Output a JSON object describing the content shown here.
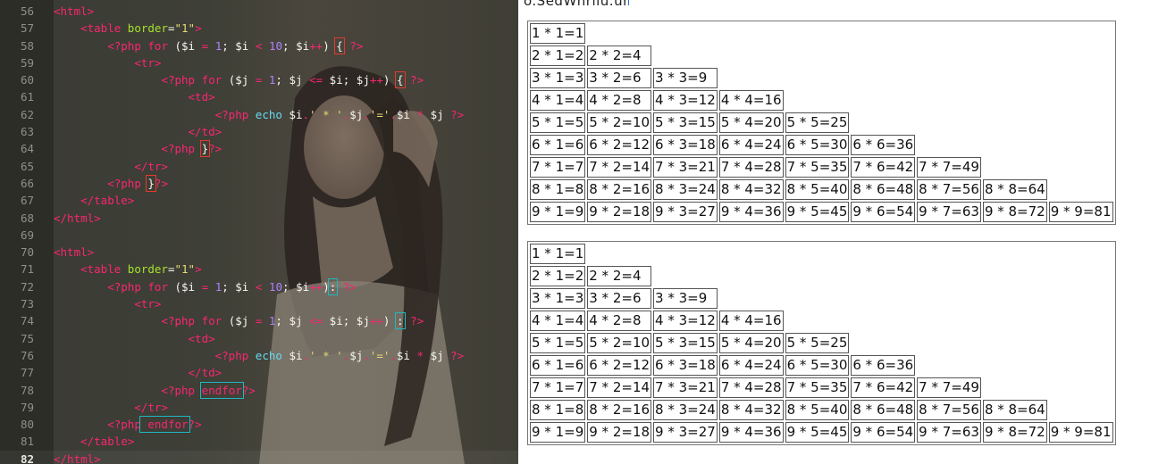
{
  "editor": {
    "lines": [
      {
        "n": "56",
        "tokens": [
          [
            "t-tag",
            "<html>"
          ]
        ]
      },
      {
        "n": "57",
        "tokens": [
          [
            "t-p",
            "    "
          ],
          [
            "t-tag",
            "<table"
          ],
          [
            "t-p",
            " "
          ],
          [
            "t-attr",
            "border"
          ],
          [
            "t-p",
            "="
          ],
          [
            "t-str",
            "\"1\""
          ],
          [
            "t-tag",
            ">"
          ]
        ]
      },
      {
        "n": "58",
        "tokens": [
          [
            "t-p",
            "        "
          ],
          [
            "t-php",
            "<?php"
          ],
          [
            "t-p",
            " "
          ],
          [
            "t-kw",
            "for"
          ],
          [
            "t-p",
            " ("
          ],
          [
            "t-var",
            "$i"
          ],
          [
            "t-p",
            " "
          ],
          [
            "t-op",
            "="
          ],
          [
            "t-p",
            " "
          ],
          [
            "t-num",
            "1"
          ],
          [
            "t-p",
            "; "
          ],
          [
            "t-var",
            "$i"
          ],
          [
            "t-p",
            " "
          ],
          [
            "t-op",
            "<"
          ],
          [
            "t-p",
            " "
          ],
          [
            "t-num",
            "10"
          ],
          [
            "t-p",
            "; "
          ],
          [
            "t-var",
            "$i"
          ],
          [
            "t-op",
            "++"
          ],
          [
            "t-p",
            ") "
          ],
          [
            "t-br box-red",
            "{"
          ],
          [
            "t-p",
            " "
          ],
          [
            "t-php",
            "?>"
          ]
        ]
      },
      {
        "n": "59",
        "tokens": [
          [
            "t-p",
            "            "
          ],
          [
            "t-tag",
            "<tr>"
          ]
        ]
      },
      {
        "n": "60",
        "tokens": [
          [
            "t-p",
            "                "
          ],
          [
            "t-php",
            "<?php"
          ],
          [
            "t-p",
            " "
          ],
          [
            "t-kw",
            "for"
          ],
          [
            "t-p",
            " ("
          ],
          [
            "t-var",
            "$j"
          ],
          [
            "t-p",
            " "
          ],
          [
            "t-op",
            "="
          ],
          [
            "t-p",
            " "
          ],
          [
            "t-num",
            "1"
          ],
          [
            "t-p",
            "; "
          ],
          [
            "t-var",
            "$j"
          ],
          [
            "t-p",
            " "
          ],
          [
            "t-op",
            "<="
          ],
          [
            "t-p",
            " "
          ],
          [
            "t-var",
            "$i"
          ],
          [
            "t-p",
            "; "
          ],
          [
            "t-var",
            "$j"
          ],
          [
            "t-op",
            "++"
          ],
          [
            "t-p",
            ") "
          ],
          [
            "t-br box-red",
            "{"
          ],
          [
            "t-p",
            " "
          ],
          [
            "t-php",
            "?>"
          ]
        ]
      },
      {
        "n": "61",
        "tokens": [
          [
            "t-p",
            "                    "
          ],
          [
            "t-tag",
            "<td>"
          ]
        ]
      },
      {
        "n": "62",
        "tokens": [
          [
            "t-p",
            "                        "
          ],
          [
            "t-php",
            "<?php"
          ],
          [
            "t-p",
            " "
          ],
          [
            "t-fn",
            "echo"
          ],
          [
            "t-p",
            " "
          ],
          [
            "t-var",
            "$i"
          ],
          [
            "t-op",
            "."
          ],
          [
            "t-str",
            "' * '"
          ],
          [
            "t-op",
            "."
          ],
          [
            "t-var",
            "$j"
          ],
          [
            "t-op",
            "."
          ],
          [
            "t-str",
            "'='"
          ],
          [
            "t-op",
            "."
          ],
          [
            "t-var",
            "$i"
          ],
          [
            "t-p",
            " "
          ],
          [
            "t-op",
            "*"
          ],
          [
            "t-p",
            " "
          ],
          [
            "t-var",
            "$j"
          ],
          [
            "t-p",
            " "
          ],
          [
            "t-php",
            "?>"
          ]
        ]
      },
      {
        "n": "63",
        "tokens": [
          [
            "t-p",
            "                    "
          ],
          [
            "t-tag",
            "</td>"
          ]
        ]
      },
      {
        "n": "64",
        "tokens": [
          [
            "t-p",
            "                "
          ],
          [
            "t-php",
            "<?php"
          ],
          [
            "t-p",
            " "
          ],
          [
            "t-br box-red",
            "}"
          ],
          [
            "t-php",
            "?>"
          ]
        ]
      },
      {
        "n": "65",
        "tokens": [
          [
            "t-p",
            "            "
          ],
          [
            "t-tag",
            "</tr>"
          ]
        ]
      },
      {
        "n": "66",
        "tokens": [
          [
            "t-p",
            "        "
          ],
          [
            "t-php",
            "<?php"
          ],
          [
            "t-p",
            " "
          ],
          [
            "t-br box-red",
            "}"
          ],
          [
            "t-php",
            "?>"
          ]
        ]
      },
      {
        "n": "67",
        "tokens": [
          [
            "t-p",
            "    "
          ],
          [
            "t-tag",
            "</table>"
          ]
        ]
      },
      {
        "n": "68",
        "tokens": [
          [
            "t-tag",
            "</html>"
          ]
        ]
      },
      {
        "n": "69",
        "tokens": []
      },
      {
        "n": "70",
        "tokens": [
          [
            "t-tag",
            "<html>"
          ]
        ]
      },
      {
        "n": "71",
        "tokens": [
          [
            "t-p",
            "    "
          ],
          [
            "t-tag",
            "<table"
          ],
          [
            "t-p",
            " "
          ],
          [
            "t-attr",
            "border"
          ],
          [
            "t-p",
            "="
          ],
          [
            "t-str",
            "\"1\""
          ],
          [
            "t-tag",
            ">"
          ]
        ]
      },
      {
        "n": "72",
        "tokens": [
          [
            "t-p",
            "        "
          ],
          [
            "t-php",
            "<?php"
          ],
          [
            "t-p",
            " "
          ],
          [
            "t-kw",
            "for"
          ],
          [
            "t-p",
            " ("
          ],
          [
            "t-var",
            "$i"
          ],
          [
            "t-p",
            " "
          ],
          [
            "t-op",
            "="
          ],
          [
            "t-p",
            " "
          ],
          [
            "t-num",
            "1"
          ],
          [
            "t-p",
            "; "
          ],
          [
            "t-var",
            "$i"
          ],
          [
            "t-p",
            " "
          ],
          [
            "t-op",
            "<"
          ],
          [
            "t-p",
            " "
          ],
          [
            "t-num",
            "10"
          ],
          [
            "t-p",
            "; "
          ],
          [
            "t-var",
            "$i"
          ],
          [
            "t-op",
            "++"
          ],
          [
            "t-p",
            ")"
          ],
          [
            "t-br box-teal",
            ":"
          ],
          [
            "t-p",
            " "
          ],
          [
            "t-php",
            "?>"
          ]
        ]
      },
      {
        "n": "73",
        "tokens": [
          [
            "t-p",
            "            "
          ],
          [
            "t-tag",
            "<tr>"
          ]
        ]
      },
      {
        "n": "74",
        "tokens": [
          [
            "t-p",
            "                "
          ],
          [
            "t-php",
            "<?php"
          ],
          [
            "t-p",
            " "
          ],
          [
            "t-kw",
            "for"
          ],
          [
            "t-p",
            " ("
          ],
          [
            "t-var",
            "$j"
          ],
          [
            "t-p",
            " "
          ],
          [
            "t-op",
            "="
          ],
          [
            "t-p",
            " "
          ],
          [
            "t-num",
            "1"
          ],
          [
            "t-p",
            "; "
          ],
          [
            "t-var",
            "$j"
          ],
          [
            "t-p",
            " "
          ],
          [
            "t-op",
            "<="
          ],
          [
            "t-p",
            " "
          ],
          [
            "t-var",
            "$i"
          ],
          [
            "t-p",
            "; "
          ],
          [
            "t-var",
            "$j"
          ],
          [
            "t-op",
            "++"
          ],
          [
            "t-p",
            ") "
          ],
          [
            "t-br box-teal",
            ":"
          ],
          [
            "t-p",
            " "
          ],
          [
            "t-php",
            "?>"
          ]
        ]
      },
      {
        "n": "75",
        "tokens": [
          [
            "t-p",
            "                    "
          ],
          [
            "t-tag",
            "<td>"
          ]
        ]
      },
      {
        "n": "76",
        "tokens": [
          [
            "t-p",
            "                        "
          ],
          [
            "t-php",
            "<?php"
          ],
          [
            "t-p",
            " "
          ],
          [
            "t-fn",
            "echo"
          ],
          [
            "t-p",
            " "
          ],
          [
            "t-var",
            "$i"
          ],
          [
            "t-op",
            "."
          ],
          [
            "t-str",
            "' * '"
          ],
          [
            "t-op",
            "."
          ],
          [
            "t-var",
            "$j"
          ],
          [
            "t-op",
            "."
          ],
          [
            "t-str",
            "'='"
          ],
          [
            "t-op",
            "."
          ],
          [
            "t-var",
            "$i"
          ],
          [
            "t-p",
            " "
          ],
          [
            "t-op",
            "*"
          ],
          [
            "t-p",
            " "
          ],
          [
            "t-var",
            "$j"
          ],
          [
            "t-p",
            " "
          ],
          [
            "t-php",
            "?>"
          ]
        ]
      },
      {
        "n": "77",
        "tokens": [
          [
            "t-p",
            "                    "
          ],
          [
            "t-tag",
            "</td>"
          ]
        ]
      },
      {
        "n": "78",
        "tokens": [
          [
            "t-p",
            "                "
          ],
          [
            "t-php",
            "<?php"
          ],
          [
            "t-p",
            " "
          ],
          [
            "t-kw box-teal",
            "endfor"
          ],
          [
            "t-php",
            "?>"
          ]
        ]
      },
      {
        "n": "79",
        "tokens": [
          [
            "t-p",
            "            "
          ],
          [
            "t-tag",
            "</tr>"
          ]
        ]
      },
      {
        "n": "80",
        "tokens": [
          [
            "t-p",
            "        "
          ],
          [
            "t-php",
            "<?php"
          ],
          [
            "t-kw box-teal",
            " endfor"
          ],
          [
            "t-php",
            "?>"
          ]
        ]
      },
      {
        "n": "81",
        "tokens": [
          [
            "t-p",
            "    "
          ],
          [
            "t-tag",
            "</table>"
          ]
        ]
      },
      {
        "n": "82",
        "tokens": [
          [
            "t-tag",
            "</html>"
          ]
        ],
        "current": true
      }
    ]
  },
  "browser": {
    "url_fragment": "o.SedWhrllu.ur"
  },
  "tables": [
    {
      "rows": [
        [
          "1 * 1=1"
        ],
        [
          "2 * 1=2",
          "2 * 2=4"
        ],
        [
          "3 * 1=3",
          "3 * 2=6",
          "3 * 3=9"
        ],
        [
          "4 * 1=4",
          "4 * 2=8",
          "4 * 3=12",
          "4 * 4=16"
        ],
        [
          "5 * 1=5",
          "5 * 2=10",
          "5 * 3=15",
          "5 * 4=20",
          "5 * 5=25"
        ],
        [
          "6 * 1=6",
          "6 * 2=12",
          "6 * 3=18",
          "6 * 4=24",
          "6 * 5=30",
          "6 * 6=36"
        ],
        [
          "7 * 1=7",
          "7 * 2=14",
          "7 * 3=21",
          "7 * 4=28",
          "7 * 5=35",
          "7 * 6=42",
          "7 * 7=49"
        ],
        [
          "8 * 1=8",
          "8 * 2=16",
          "8 * 3=24",
          "8 * 4=32",
          "8 * 5=40",
          "8 * 6=48",
          "8 * 7=56",
          "8 * 8=64"
        ],
        [
          "9 * 1=9",
          "9 * 2=18",
          "9 * 3=27",
          "9 * 4=36",
          "9 * 5=45",
          "9 * 6=54",
          "9 * 7=63",
          "9 * 8=72",
          "9 * 9=81"
        ]
      ]
    },
    {
      "rows": [
        [
          "1 * 1=1"
        ],
        [
          "2 * 1=2",
          "2 * 2=4"
        ],
        [
          "3 * 1=3",
          "3 * 2=6",
          "3 * 3=9"
        ],
        [
          "4 * 1=4",
          "4 * 2=8",
          "4 * 3=12",
          "4 * 4=16"
        ],
        [
          "5 * 1=5",
          "5 * 2=10",
          "5 * 3=15",
          "5 * 4=20",
          "5 * 5=25"
        ],
        [
          "6 * 1=6",
          "6 * 2=12",
          "6 * 3=18",
          "6 * 4=24",
          "6 * 5=30",
          "6 * 6=36"
        ],
        [
          "7 * 1=7",
          "7 * 2=14",
          "7 * 3=21",
          "7 * 4=28",
          "7 * 5=35",
          "7 * 6=42",
          "7 * 7=49"
        ],
        [
          "8 * 1=8",
          "8 * 2=16",
          "8 * 3=24",
          "8 * 4=32",
          "8 * 5=40",
          "8 * 6=48",
          "8 * 7=56",
          "8 * 8=64"
        ],
        [
          "9 * 1=9",
          "9 * 2=18",
          "9 * 3=27",
          "9 * 4=36",
          "9 * 5=45",
          "9 * 6=54",
          "9 * 7=63",
          "9 * 8=72",
          "9 * 9=81"
        ]
      ]
    }
  ]
}
